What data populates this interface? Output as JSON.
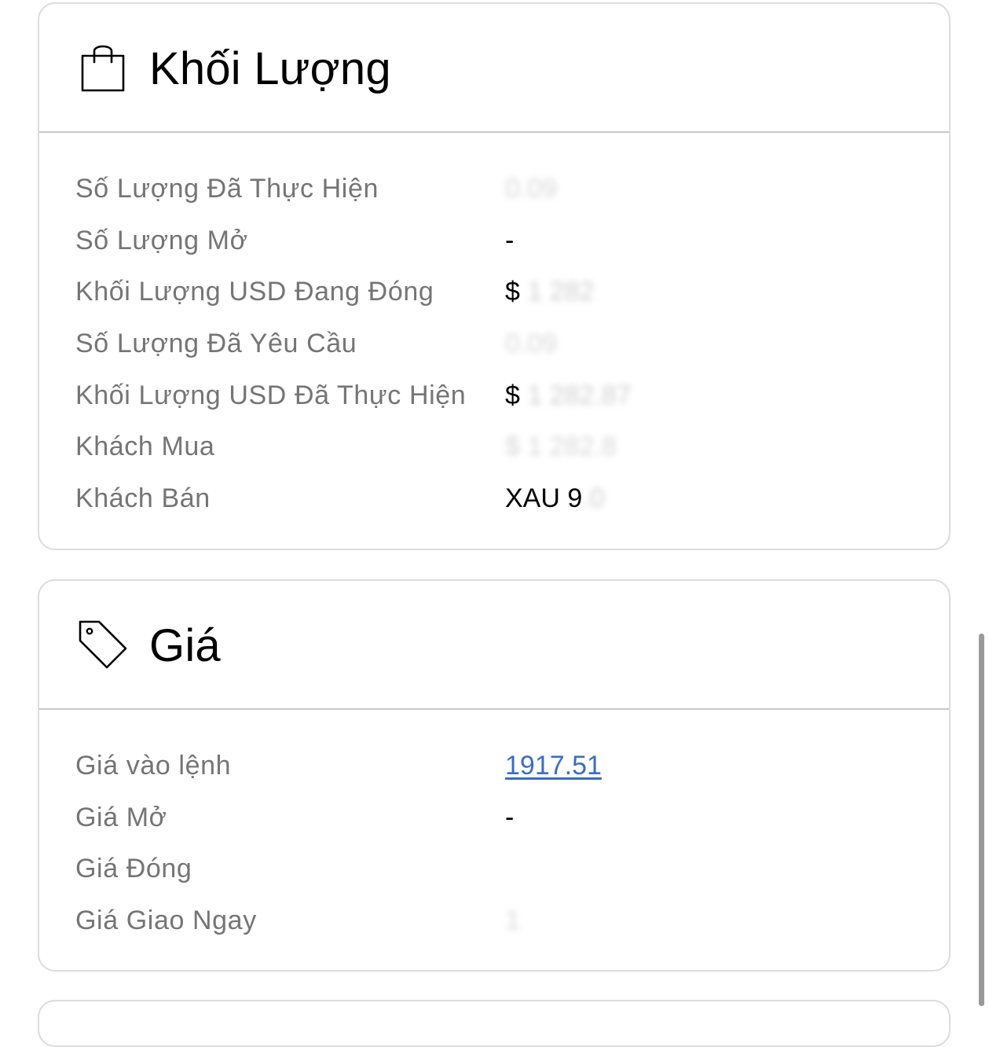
{
  "volume_card": {
    "title": "Khối Lượng",
    "icon": "shopping-bag-icon",
    "rows": [
      {
        "label": "Số Lượng Đã Thực Hiện",
        "prefix": "",
        "value": "0.09"
      },
      {
        "label": "Số Lượng Mở",
        "prefix": "-",
        "value": ""
      },
      {
        "label": "Khối Lượng USD Đang Đóng",
        "prefix": "$ ",
        "value": "1 282"
      },
      {
        "label": "Số Lượng Đã Yêu Cầu",
        "prefix": "",
        "value": "0.09"
      },
      {
        "label": "Khối Lượng USD Đã Thực Hiện",
        "prefix": "$ ",
        "value": "1 282.87"
      },
      {
        "label": "Khách Mua",
        "prefix": "",
        "value": "$ 1 282.8"
      },
      {
        "label": "Khách Bán",
        "prefix": "XAU 9",
        "value": ".0"
      }
    ]
  },
  "price_card": {
    "title": "Giá",
    "icon": "price-tag-icon",
    "rows": [
      {
        "label": "Giá vào lệnh",
        "value": "1917.51"
      },
      {
        "label": "Giá Mở",
        "value": "-"
      },
      {
        "label": "Giá Đóng",
        "value": ""
      },
      {
        "label": "Giá Giao Ngay",
        "value": "1"
      }
    ]
  }
}
